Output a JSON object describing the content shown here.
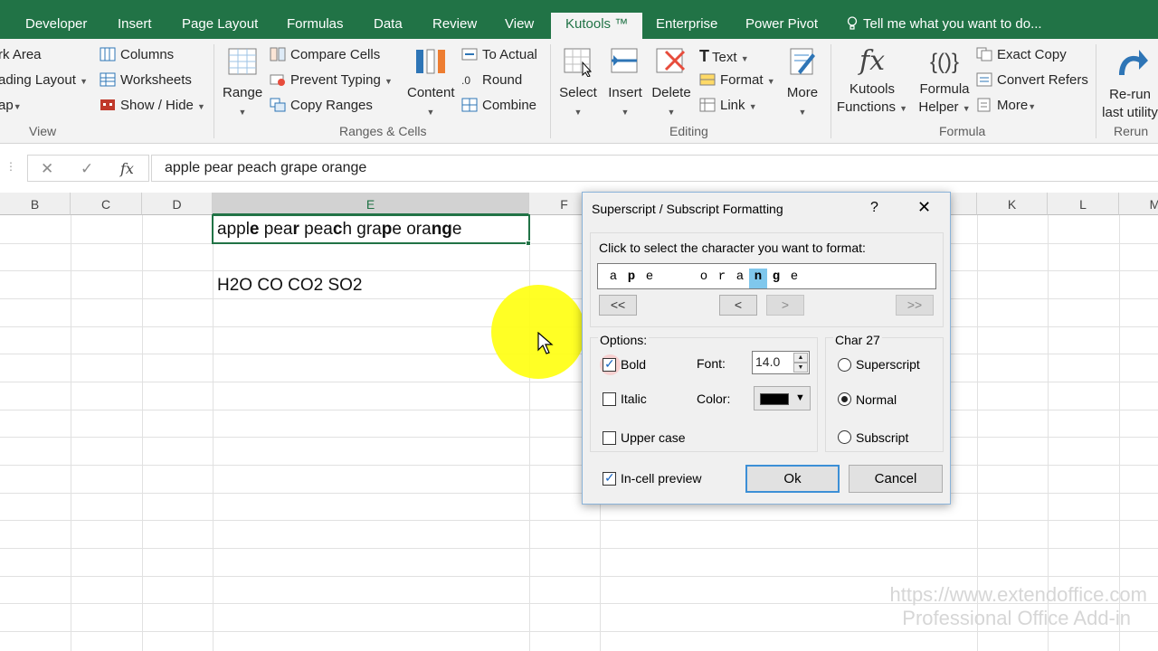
{
  "tabs": [
    "Developer",
    "Insert",
    "Page Layout",
    "Formulas",
    "Data",
    "Review",
    "View",
    "Kutools ™",
    "Enterprise",
    "Power Pivot"
  ],
  "tell_me": "Tell me what you want to do...",
  "ribbon": {
    "view_group": {
      "items": [
        "rk Area",
        "ading Layout",
        "ap"
      ],
      "label": "View"
    },
    "ws_group": {
      "items": [
        "Columns",
        "Worksheets",
        "Show / Hide"
      ]
    },
    "ranges_group": {
      "range_btn": "Range",
      "items": [
        "Compare Cells",
        "Prevent Typing",
        "Copy Ranges"
      ],
      "content_btn": "Content",
      "items2": [
        "To Actual",
        "Round",
        "Combine"
      ],
      "label": "Ranges & Cells"
    },
    "editing_group": {
      "select_btn": "Select",
      "insert_btn": "Insert",
      "delete_btn": "Delete",
      "items": [
        "Text",
        "Format",
        "Link"
      ],
      "more_btn": "More",
      "label": "Editing"
    },
    "formula_group": {
      "kutools_functions": [
        "Kutools",
        "Functions"
      ],
      "formula_helper": [
        "Formula",
        "Helper"
      ],
      "items": [
        "Exact Copy",
        "Convert Refers",
        "More"
      ],
      "label": "Formula"
    },
    "rerun_group": {
      "btn": [
        "Re-run",
        "last utility"
      ],
      "label": "Rerun"
    }
  },
  "formula_bar": {
    "fx": "fx",
    "value": "apple pear peach grape orange"
  },
  "columns": [
    "B",
    "C",
    "D",
    "E",
    "F",
    "K",
    "L",
    "M"
  ],
  "cells": {
    "e1": [
      {
        "t": "appl",
        "b": false
      },
      {
        "t": "e",
        "b": true
      },
      {
        "t": " pea",
        "b": false
      },
      {
        "t": "r",
        "b": true
      },
      {
        "t": " pea",
        "b": false
      },
      {
        "t": "c",
        "b": true
      },
      {
        "t": "h gra",
        "b": false
      },
      {
        "t": "p",
        "b": true
      },
      {
        "t": "e ora",
        "b": false
      },
      {
        "t": "n",
        "b": true
      },
      {
        "t": "g",
        "b": true
      },
      {
        "t": "e",
        "b": false
      }
    ],
    "e3": "H2O CO CO2 SO2"
  },
  "dialog": {
    "title": "Superscript / Subscript Formatting",
    "help": "?",
    "close": "✕",
    "prompt": "Click to select the character you want to format:",
    "chars": [
      {
        "c": "a",
        "s": ""
      },
      {
        "c": "p",
        "s": "b"
      },
      {
        "c": "e",
        "s": ""
      },
      {
        "c": " ",
        "s": ""
      },
      {
        "c": "o",
        "s": ""
      },
      {
        "c": "r",
        "s": ""
      },
      {
        "c": "a",
        "s": ""
      },
      {
        "c": "n",
        "s": "hl"
      },
      {
        "c": "g",
        "s": "b"
      },
      {
        "c": "e",
        "s": ""
      }
    ],
    "nav": [
      "<<",
      "<",
      ">",
      ">>"
    ],
    "options_label": "Options:",
    "bold": "Bold",
    "italic": "Italic",
    "upper_case": "Upper case",
    "font_label": "Font:",
    "font_size": "14.0",
    "color_label": "Color:",
    "char_label": "Char 27",
    "superscript": "Superscript",
    "normal": "Normal",
    "subscript": "Subscript",
    "preview": "In-cell preview",
    "ok": "Ok",
    "cancel": "Cancel",
    "state": {
      "bold": true,
      "italic": false,
      "upper_case": false,
      "preview": true,
      "position": "Normal"
    }
  },
  "watermark": [
    "https://www.extendoffice.com",
    "Professional Office Add-in"
  ],
  "colors": {
    "excel_green": "#217346",
    "ribbon_bg": "#f3f3f3",
    "highlight": "#ffff12",
    "char_select": "#7fc7ec"
  }
}
